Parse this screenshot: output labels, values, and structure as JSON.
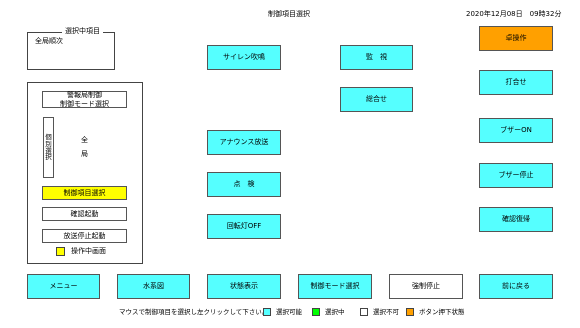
{
  "header": {
    "title": "制御項目選択",
    "datetime": "2020年12月08日　09時32分"
  },
  "selected_item": {
    "legend": "選択中項目",
    "value": "全局順次"
  },
  "left_panel": {
    "mode_select": "警報局制御\n制御モード選択",
    "individual_select": "個\n別\n選\n択",
    "all_stations": "全\n\n局",
    "item_select": "制御項目選択",
    "confirm_start": "確認起動",
    "broadcast_stop_start": "放送停止起動",
    "operating_screen_label": "操作中画面",
    "colors": {
      "highlight": "#ffff00"
    }
  },
  "center_buttons": {
    "siren": "サイレン吹鳴",
    "announce": "アナウンス放送",
    "bell": "点　検",
    "rotating_light_off": "回転灯OFF"
  },
  "middle_buttons": {
    "monitor": "監　視",
    "alignment": "総合せ"
  },
  "right_buttons": {
    "desk_operation": "卓操作",
    "meeting": "打合せ",
    "buzzer_on": "ブザーON",
    "buzzer_stop": "ブザー停止",
    "confirm_restore": "確認復帰"
  },
  "bottom_bar": {
    "menu": "メニュー",
    "water_level": "水系図",
    "status_display": "状態表示",
    "control_mode_select": "制御モード選択",
    "forced_stop": "強制停止",
    "back": "前に戻る"
  },
  "instructions": {
    "text": "マウスで制御項目を選択し左クリックして下さい。",
    "legend": [
      {
        "label": "選択可能",
        "color": "#55ffff"
      },
      {
        "label": "選択中",
        "color": "#00ff00"
      },
      {
        "label": "選択不可",
        "color": "#ffffff"
      },
      {
        "label": "ボタン押下状態",
        "color": "#ffa000"
      }
    ]
  }
}
